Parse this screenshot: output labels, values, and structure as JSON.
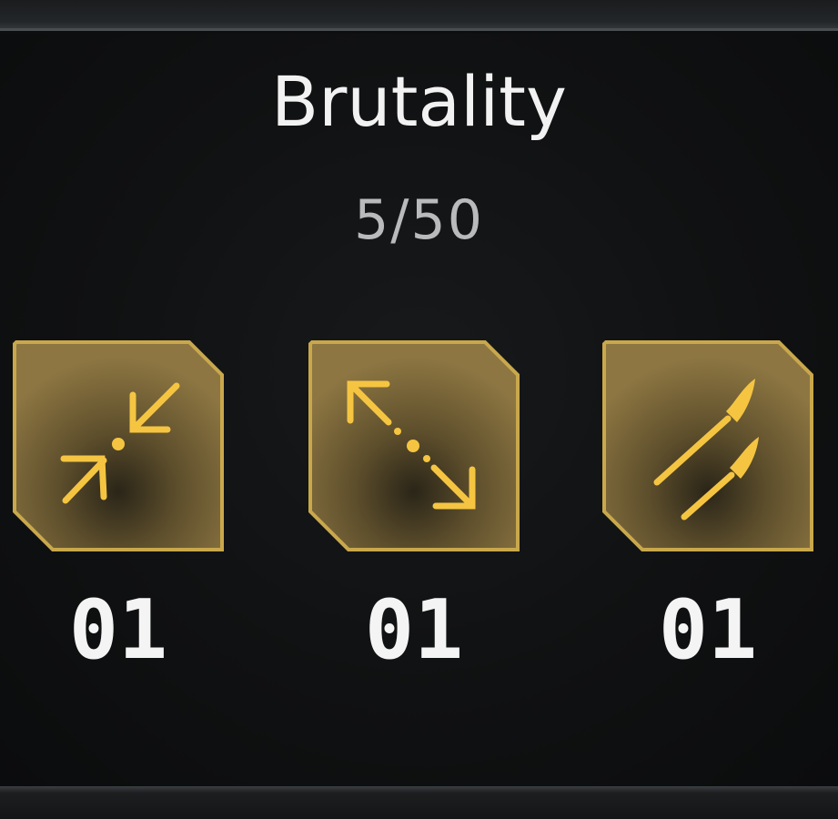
{
  "header": {
    "title": "Brutality",
    "progress": "5/50"
  },
  "colors": {
    "accent": "#f5c542",
    "tile_fill": "#8a7440",
    "tile_border": "#c9a84c",
    "text": "#f2f2f2",
    "subtext": "#b9babb"
  },
  "rewards": [
    {
      "icon": "collapse-arrows-icon",
      "count": "01"
    },
    {
      "icon": "expand-arrows-icon",
      "count": "01"
    },
    {
      "icon": "bullets-icon",
      "count": "01"
    }
  ]
}
